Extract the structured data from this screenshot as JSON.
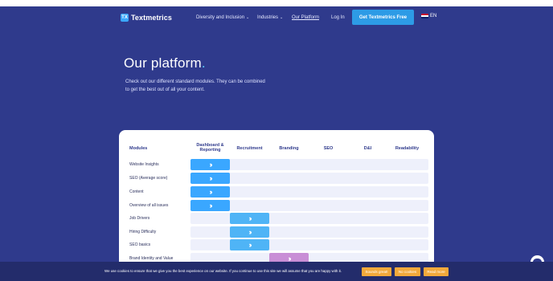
{
  "header": {
    "logo_mark": "TX",
    "logo_text": "Textmetrics",
    "nav": [
      {
        "label": "Diversity and Inclusion",
        "has_dropdown": true
      },
      {
        "label": "Industries",
        "has_dropdown": true
      },
      {
        "label": "Our Platform",
        "has_dropdown": false,
        "active": true
      },
      {
        "label": "Log In",
        "has_dropdown": false
      }
    ],
    "cta_label": "Get Textmetrics Free",
    "language": "EN"
  },
  "hero": {
    "title": "Our platform",
    "title_dot": ".",
    "subtitle": "Check out our different standard modules. They can be combined to get the best out of all your content."
  },
  "table": {
    "columns": [
      "Modules",
      "Dashboard & Reporting",
      "Recruitment",
      "Branding",
      "SEO",
      "D&I",
      "Readability"
    ],
    "rows": [
      {
        "label": "Website Insights",
        "column": "Dashboard & Reporting"
      },
      {
        "label": "SEO (Average score)",
        "column": "Dashboard & Reporting"
      },
      {
        "label": "Content",
        "column": "Dashboard & Reporting"
      },
      {
        "label": "Overview of all issues",
        "column": "Dashboard & Reporting"
      },
      {
        "label": "Job Drivers",
        "column": "Recruitment"
      },
      {
        "label": "Hiring Difficulty",
        "column": "Recruitment"
      },
      {
        "label": "SEO basics",
        "column": "Recruitment"
      },
      {
        "label": "Brand Identity and Value",
        "column": "Branding"
      }
    ]
  },
  "cookie": {
    "text": "We use cookies to ensure that we give you the best experience on our website. If you continue to use this site we will assume that you are happy with it.",
    "buttons": [
      "Sounds great!",
      "No cookies",
      "Read more"
    ]
  },
  "colors": {
    "background": "#2f3a8c",
    "cta": "#2d9be6",
    "dashboard": "#3aa7ff",
    "recruitment": "#4fb4f6",
    "branding": "#c98ed6",
    "cookie_button": "#f2a93b"
  },
  "icons": {
    "chevrons": "double-chevron-right-icon",
    "chat": "chat-bubble-icon",
    "flag": "uk-flag-icon"
  }
}
